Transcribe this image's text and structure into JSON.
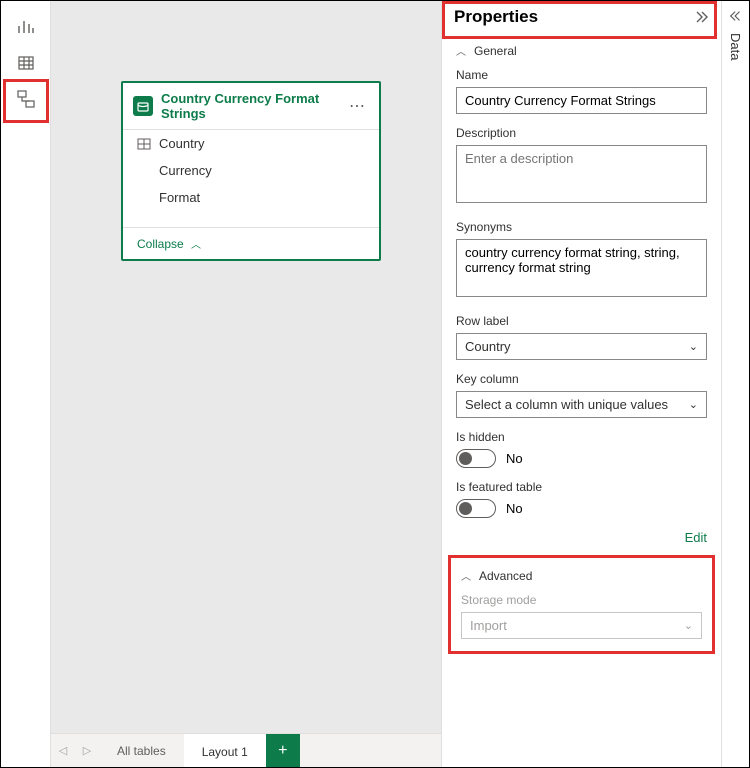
{
  "leftRail": {
    "report": "report",
    "data": "data",
    "model": "model"
  },
  "table": {
    "title": "Country Currency Format Strings",
    "fields": [
      "Country",
      "Currency",
      "Format"
    ],
    "collapse": "Collapse"
  },
  "tabs": {
    "all": "All tables",
    "layout": "Layout 1"
  },
  "properties": {
    "title": "Properties",
    "sections": {
      "general": "General",
      "advanced": "Advanced"
    },
    "name": {
      "label": "Name",
      "value": "Country Currency Format Strings"
    },
    "description": {
      "label": "Description",
      "placeholder": "Enter a description"
    },
    "synonyms": {
      "label": "Synonyms",
      "value": "country currency format string, string, currency format string"
    },
    "rowLabel": {
      "label": "Row label",
      "value": "Country"
    },
    "keyColumn": {
      "label": "Key column",
      "value": "Select a column with unique values"
    },
    "isHidden": {
      "label": "Is hidden",
      "value": "No"
    },
    "isFeatured": {
      "label": "Is featured table",
      "value": "No"
    },
    "edit": "Edit",
    "storageMode": {
      "label": "Storage mode",
      "value": "Import"
    }
  },
  "rightRail": {
    "label": "Data"
  }
}
